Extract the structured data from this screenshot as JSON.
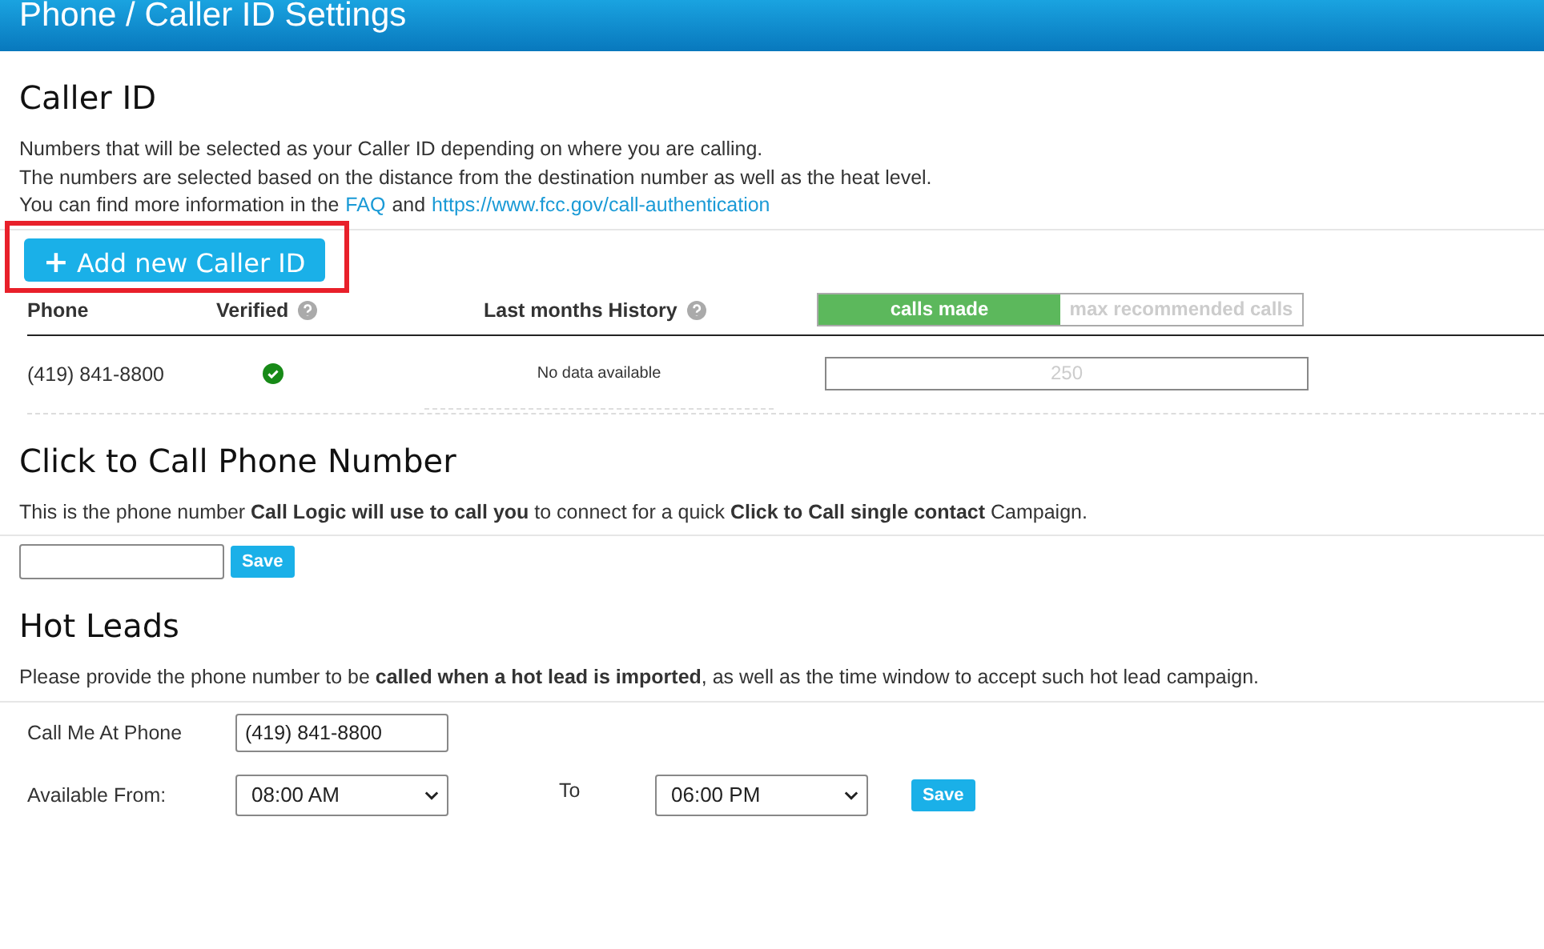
{
  "header": {
    "title": "Phone / Caller ID Settings"
  },
  "caller_id": {
    "heading": "Caller ID",
    "description": [
      "Numbers that will be selected as your Caller ID depending on where you are calling.",
      "The numbers are selected based on the distance from the destination number as well as the heat level."
    ],
    "info": {
      "prefix": "You can find more information in the",
      "faq_link": "FAQ",
      "joiner": "and",
      "url_link": "https://www.fcc.gov/call-authentication"
    },
    "add_button": {
      "icon": "+",
      "label": "Add new Caller ID",
      "highlighted": true
    },
    "table": {
      "columns": [
        {
          "label": "Phone",
          "help": false
        },
        {
          "label": "Verified",
          "help": true
        },
        {
          "label": "Last months History",
          "help": true
        }
      ],
      "legend": [
        {
          "label": "calls made",
          "selected": true
        },
        {
          "label": "max recommended calls",
          "selected": false
        }
      ],
      "rows": [
        {
          "phone": "(419) 841-8800",
          "verified": true,
          "history": "No data available",
          "max_calls": "250"
        }
      ]
    }
  },
  "click_to_call": {
    "heading": "Click to Call Phone Number",
    "description": "This is the phone number **Call Logic will use to call you** to connect for a quick **Click to Call single contact** Campaign.",
    "save": "Save"
  },
  "hot_leads": {
    "heading": "Hot Leads",
    "description": "Please provide the phone number to be **called when a hot lead is imported**, as well as the time window to accept such hot lead campaign.",
    "phone_label": "Call Me At Phone",
    "phone_value": "(419) 841-8800",
    "from_label": "Available From:",
    "from_value": "08:00 AM",
    "to_label": "To",
    "to_value": "06:00 PM",
    "save": "Save"
  }
}
